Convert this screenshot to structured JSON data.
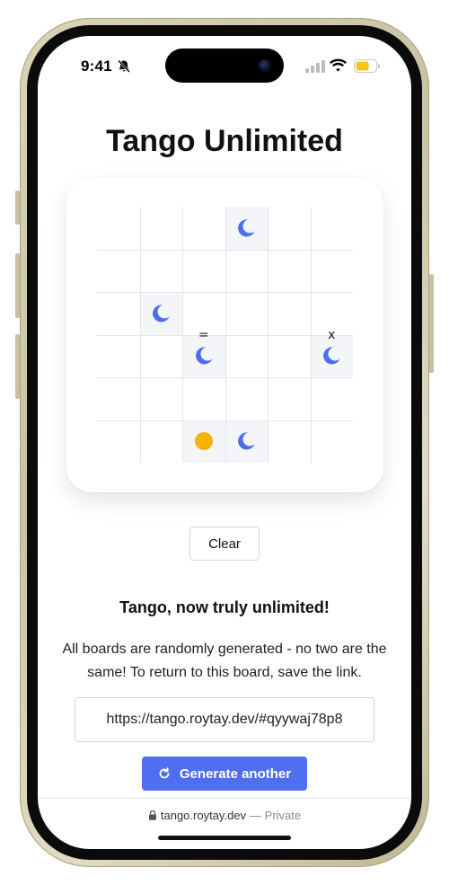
{
  "status_bar": {
    "time": "9:41",
    "icons": [
      "bell-slash-icon",
      "signal-icon",
      "wifi-icon",
      "battery-icon"
    ],
    "battery_color": "#f5c518"
  },
  "page": {
    "title": "Tango Unlimited"
  },
  "board": {
    "size": 6,
    "colors": {
      "moon": "#4b6ef0",
      "sun": "#f5b301",
      "locked_cell_bg": "#f3f5f8",
      "grid_line": "#e3e5e8"
    },
    "cells": [
      {
        "row": 0,
        "col": 3,
        "piece": "moon",
        "locked": true
      },
      {
        "row": 2,
        "col": 1,
        "piece": "moon",
        "locked": true
      },
      {
        "row": 3,
        "col": 2,
        "piece": "moon",
        "locked": true
      },
      {
        "row": 3,
        "col": 5,
        "piece": "moon",
        "locked": true
      },
      {
        "row": 5,
        "col": 2,
        "piece": "sun",
        "locked": true
      },
      {
        "row": 5,
        "col": 3,
        "piece": "moon",
        "locked": true
      }
    ],
    "constraints": [
      {
        "between": [
          [
            2,
            2
          ],
          [
            3,
            2
          ]
        ],
        "symbol": "="
      },
      {
        "between": [
          [
            2,
            5
          ],
          [
            3,
            5
          ]
        ],
        "symbol": "x"
      }
    ]
  },
  "controls": {
    "clear_label": "Clear"
  },
  "info": {
    "subtitle": "Tango, now truly unlimited!",
    "description": "All boards are randomly generated - no two are the same! To return to this board, save the link.",
    "share_url": "https://tango.roytay.dev/#qyywaj78p8",
    "generate_label": "Generate another"
  },
  "browser": {
    "domain": "tango.roytay.dev",
    "privacy": "— Private"
  }
}
